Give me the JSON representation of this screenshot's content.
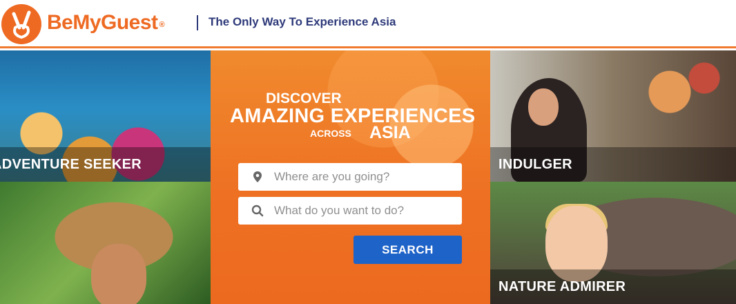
{
  "header": {
    "brand_name": "BeMyGuest",
    "registered_mark": "®",
    "tagline": "The Only Way To Experience Asia",
    "logo_icon": "peace-hand-icon",
    "brand_color": "#ee6a23",
    "tagline_color": "#2e3a7a"
  },
  "tiles": {
    "adventure": {
      "label": "ADVENTURE SEEKER"
    },
    "indulger": {
      "label": "INDULGER"
    },
    "nature": {
      "label": "NATURE ADMIRER"
    }
  },
  "hero": {
    "line1": "DISCOVER",
    "line2": "AMAZING EXPERIENCES",
    "line3_small": "ACROSS",
    "line3_big": "ASIA",
    "background_color": "#ee6f22"
  },
  "search": {
    "where_placeholder": "Where are you going?",
    "where_icon": "map-pin-icon",
    "what_placeholder": "What do you want to do?",
    "what_icon": "search-icon",
    "button_label": "SEARCH",
    "button_color": "#1e63c8"
  }
}
